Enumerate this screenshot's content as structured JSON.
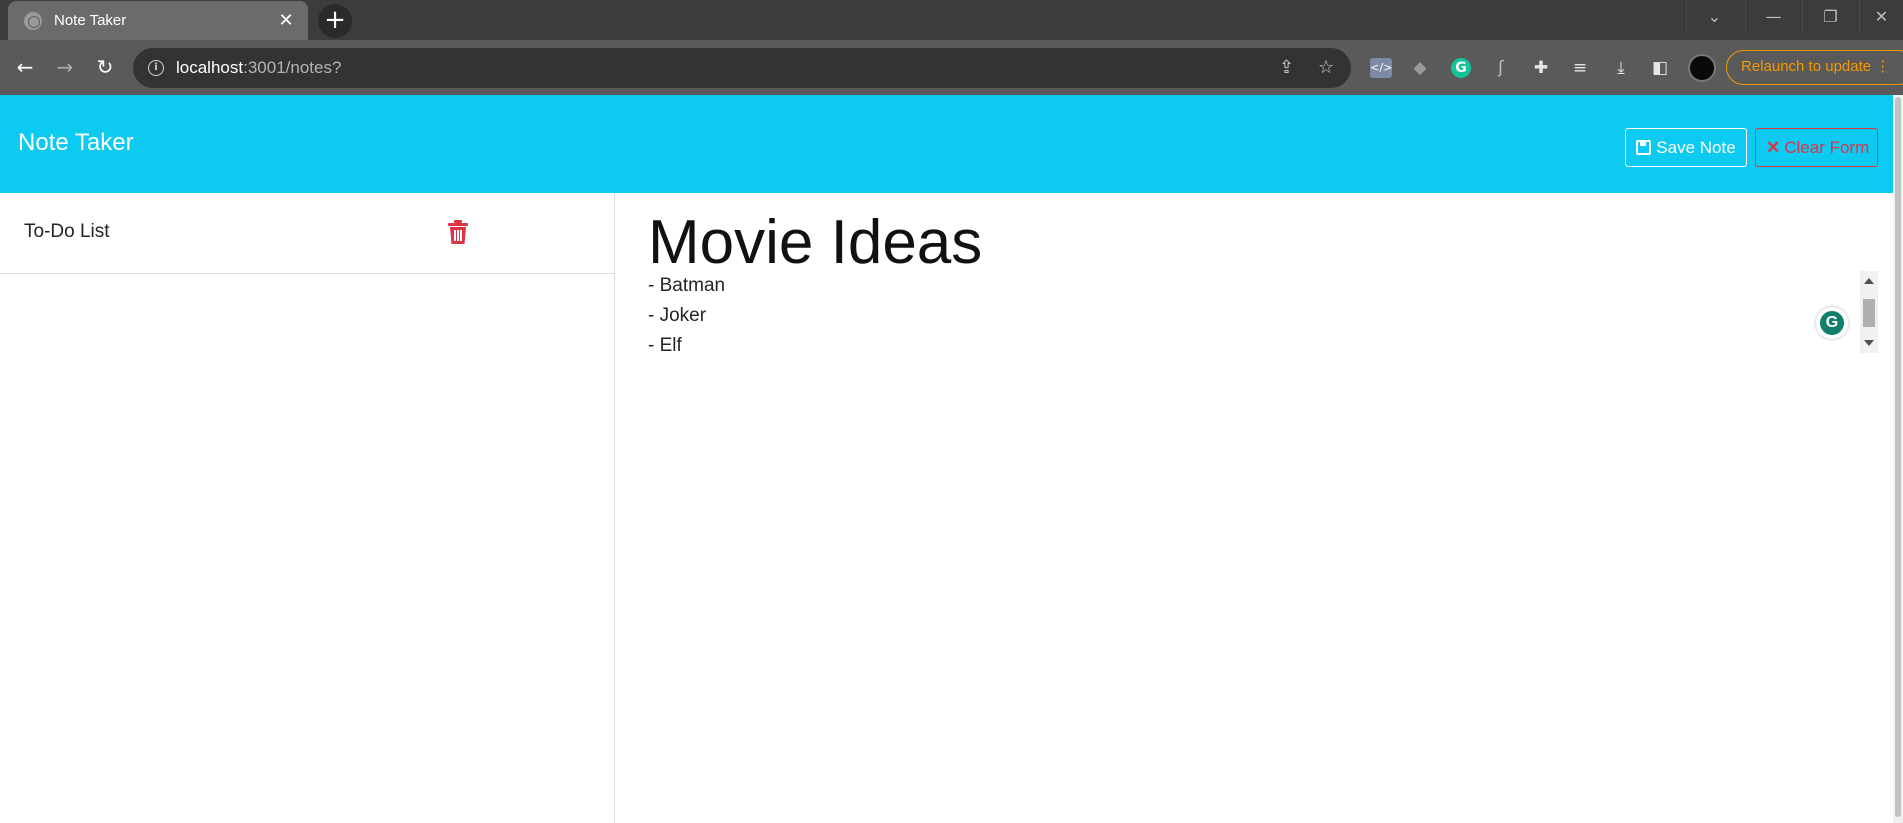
{
  "browser": {
    "tab_title": "Note Taker",
    "tab_close": "✕",
    "new_tab": "+",
    "url_host": "localhost",
    "url_path": ":3001/notes?",
    "relaunch_label": "Relaunch to update",
    "relaunch_color": "#f29900"
  },
  "app": {
    "brand": "Note Taker",
    "accent_color": "#0dcaf0",
    "danger_color": "#dc3545",
    "save_label": "Save Note",
    "clear_label": "Clear Form"
  },
  "notes_list": [
    {
      "title": "To-Do List"
    }
  ],
  "active_note": {
    "title": "Movie Ideas",
    "text": "- Batman\n- Joker\n- Elf"
  },
  "grammarly_badge": "G"
}
